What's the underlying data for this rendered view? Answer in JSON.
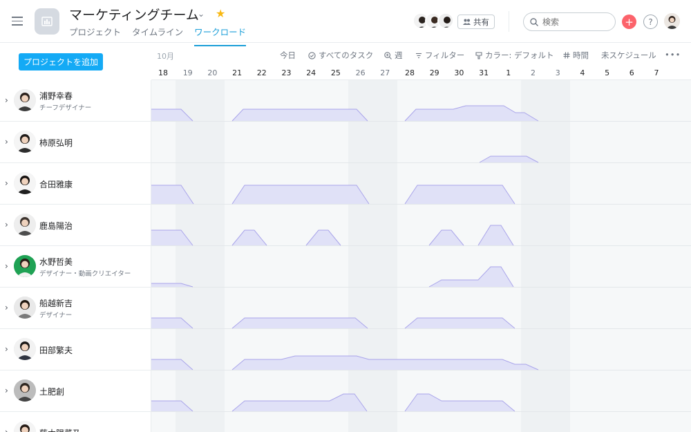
{
  "header": {
    "title": "マーケティングチーム",
    "tabs": [
      {
        "label": "プロジェクト",
        "active": false
      },
      {
        "label": "タイムライン",
        "active": false
      },
      {
        "label": "ワークロード",
        "active": true
      }
    ],
    "share_label": "共有",
    "search_placeholder": "検索"
  },
  "toolbar": {
    "add_project": "プロジェクトを追加",
    "month": "10月",
    "today": "今日",
    "all_tasks": "すべてのタスク",
    "week": "週",
    "filter": "フィルター",
    "color": "カラー: デフォルト",
    "hours": "時間",
    "unscheduled": "未スケジュール",
    "more": "•••"
  },
  "dates": [
    "18",
    "19",
    "20",
    "21",
    "22",
    "23",
    "24",
    "25",
    "26",
    "27",
    "28",
    "29",
    "30",
    "31",
    "1",
    "2",
    "3",
    "4",
    "5",
    "6",
    "7"
  ],
  "weekend_dates": [
    "19",
    "20",
    "26",
    "27",
    "2",
    "3"
  ],
  "people": [
    {
      "name": "浦野幸春",
      "role": "チーフデザイナー"
    },
    {
      "name": "柿原弘明",
      "role": ""
    },
    {
      "name": "合田雅康",
      "role": ""
    },
    {
      "name": "鹿島陽治",
      "role": ""
    },
    {
      "name": "水野哲美",
      "role": "デザイナー・動画クリエイター"
    },
    {
      "name": "船越新吉",
      "role": "デザイナー"
    },
    {
      "name": "田部繁夫",
      "role": ""
    },
    {
      "name": "土肥創",
      "role": ""
    },
    {
      "name": "藤木陽菜乃",
      "role": ""
    }
  ],
  "colors": {
    "accent": "#1a9ed8",
    "add_button": "#14aaf5",
    "load_fill": "#e0e1f7",
    "load_stroke": "#a9a4ea",
    "star": "#f8b812",
    "plus": "#fc636b"
  }
}
